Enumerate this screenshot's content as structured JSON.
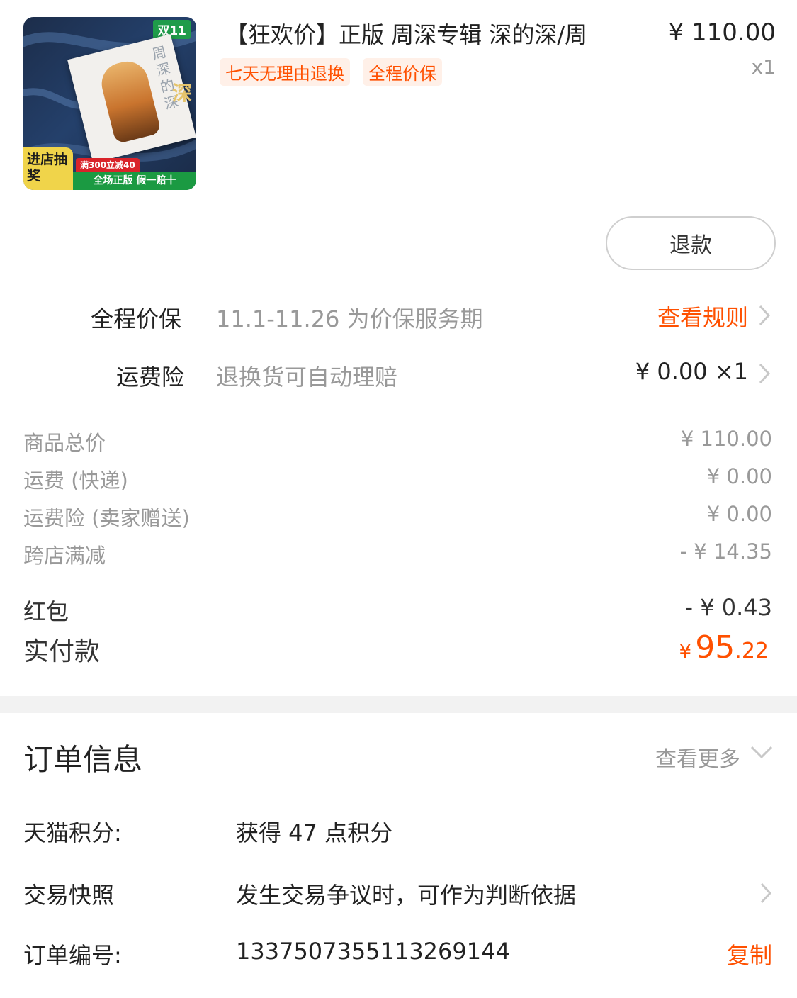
{
  "product": {
    "title": "【狂欢价】正版 周深专辑 深的深/周",
    "price": "¥ 110.00",
    "quantity": "x1",
    "tags": [
      "七天无理由退换",
      "全程价保"
    ],
    "thumbnail": {
      "badge": "双11",
      "cover_title": "周深的深",
      "side_char": "深",
      "entry_badge": "进店抽奖",
      "promo_red": "满300立减40",
      "promo_green": "全场正版 假一赔十"
    },
    "refund_label": "退款"
  },
  "services": [
    {
      "label": "全程价保",
      "desc": "11.1-11.26 为价保服务期",
      "action": "查看规则",
      "action_color": "#ff5000"
    },
    {
      "label": "运费险",
      "desc": "退换货可自动理赔",
      "action": "¥ 0.00 ×1",
      "action_color": "#222222"
    }
  ],
  "breakdown": [
    {
      "label": "商品总价",
      "value": "¥ 110.00"
    },
    {
      "label": "运费 (快递)",
      "value": "¥ 0.00"
    },
    {
      "label": "运费险 (卖家赠送)",
      "value": "¥ 0.00"
    },
    {
      "label": "跨店满减",
      "value": "- ¥ 14.35"
    }
  ],
  "red_packet": {
    "label": "红包",
    "value": "- ¥ 0.43"
  },
  "paid": {
    "label": "实付款",
    "currency": "¥",
    "integer": "95",
    "decimal": ".22"
  },
  "order_info": {
    "title": "订单信息",
    "more": "查看更多",
    "rows": [
      {
        "label": "天猫积分:",
        "value": "获得 47 点积分"
      },
      {
        "label": "交易快照",
        "value": "发生交易争议时，可作为判断依据"
      },
      {
        "label": "订单编号:",
        "value": "1337507355113269144",
        "action": "复制"
      }
    ]
  },
  "colors": {
    "accent": "#ff5000",
    "muted": "#999999",
    "text": "#222222"
  }
}
